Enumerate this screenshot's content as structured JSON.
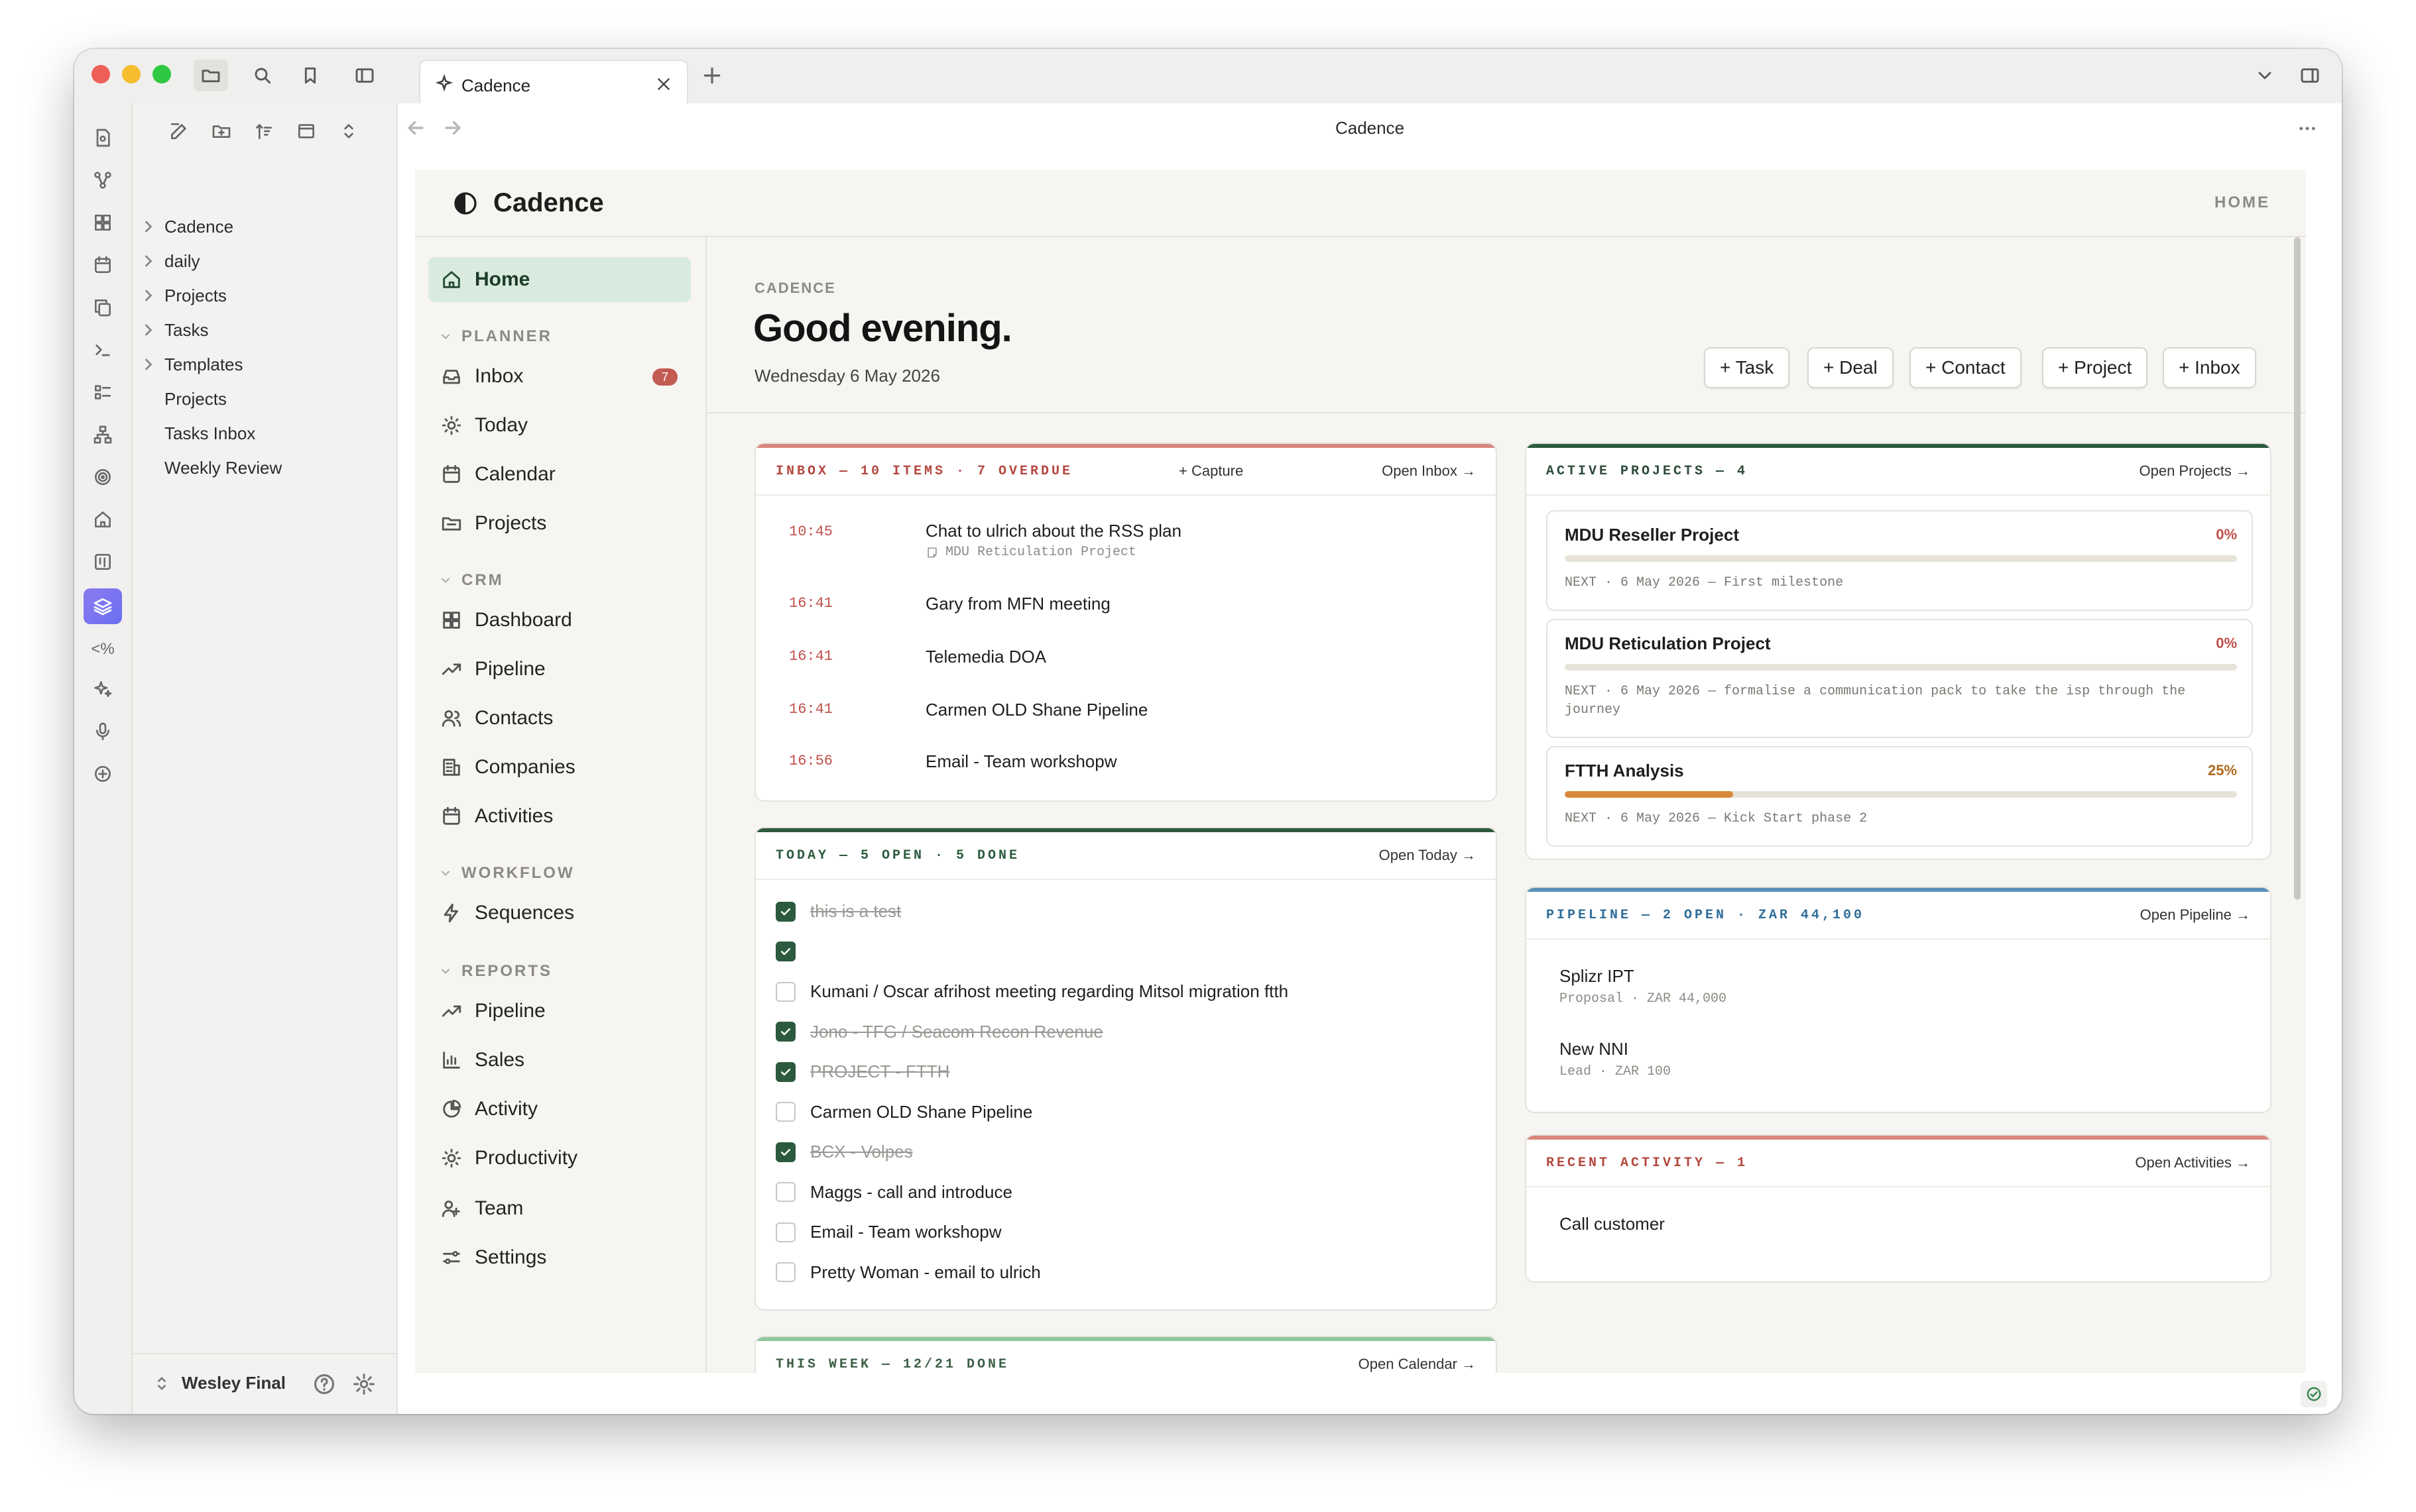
{
  "tab": {
    "label": "Cadence"
  },
  "view_title": "Cadence",
  "explorer": {
    "folders": [
      "Cadence",
      "daily",
      "Projects",
      "Tasks",
      "Templates"
    ],
    "files": [
      "Projects",
      "Tasks Inbox",
      "Weekly Review"
    ],
    "vault_name": "Wesley Final"
  },
  "app": {
    "brand": "Cadence",
    "breadcrumb": "HOME",
    "nav": {
      "home": "Home",
      "planner_title": "PLANNER",
      "planner": [
        {
          "label": "Inbox",
          "icon": "inbox-icon",
          "badge": "7"
        },
        {
          "label": "Today",
          "icon": "sun-icon"
        },
        {
          "label": "Calendar",
          "icon": "calendar-icon"
        },
        {
          "label": "Projects",
          "icon": "folder-icon"
        }
      ],
      "crm_title": "CRM",
      "crm": [
        {
          "label": "Dashboard",
          "icon": "dashboard-icon"
        },
        {
          "label": "Pipeline",
          "icon": "trend-icon"
        },
        {
          "label": "Contacts",
          "icon": "users-icon"
        },
        {
          "label": "Companies",
          "icon": "building-icon"
        },
        {
          "label": "Activities",
          "icon": "calendar-icon"
        }
      ],
      "workflow_title": "WORKFLOW",
      "workflow": [
        {
          "label": "Sequences",
          "icon": "bolt-icon"
        }
      ],
      "reports_title": "REPORTS",
      "reports": [
        {
          "label": "Pipeline",
          "icon": "trend-icon"
        },
        {
          "label": "Sales",
          "icon": "bar-chart-icon"
        },
        {
          "label": "Activity",
          "icon": "pie-icon"
        },
        {
          "label": "Productivity",
          "icon": "sun-icon"
        },
        {
          "label": "Team",
          "icon": "team-icon"
        },
        {
          "label": "Settings",
          "icon": "sliders-icon"
        }
      ]
    },
    "header": {
      "eyebrow": "CADENCE",
      "greeting": "Good evening.",
      "date": "Wednesday 6 May 2026",
      "actions": [
        "+ Task",
        "+ Deal",
        "+ Contact",
        "+ Project",
        "+ Inbox"
      ]
    },
    "inbox": {
      "title": "INBOX — 10 ITEMS · 7 OVERDUE",
      "capture": "+ Capture",
      "link": "Open Inbox →",
      "items": [
        {
          "time": "10:45",
          "text": "Chat to ulrich about the RSS plan",
          "sub": "MDU Reticulation Project"
        },
        {
          "time": "16:41",
          "text": "Gary from MFN meeting"
        },
        {
          "time": "16:41",
          "text": "Telemedia DOA"
        },
        {
          "time": "16:41",
          "text": "Carmen OLD Shane Pipeline"
        },
        {
          "time": "16:56",
          "text": "Email - Team workshopw"
        }
      ]
    },
    "today": {
      "title": "TODAY — 5 OPEN · 5 DONE",
      "link": "Open Today →",
      "items": [
        {
          "text": "this is a test",
          "done": true
        },
        {
          "text": "",
          "done": true
        },
        {
          "text": "Kumani / Oscar afrihost meeting regarding Mitsol migration ftth",
          "done": false
        },
        {
          "text": "Jono - TFG / Seacom Recon Revenue",
          "done": true
        },
        {
          "text": "PROJECT - FTTH",
          "done": true
        },
        {
          "text": "Carmen OLD Shane Pipeline",
          "done": false
        },
        {
          "text": "BCX - Volpes",
          "done": true
        },
        {
          "text": "Maggs - call and introduce",
          "done": false
        },
        {
          "text": "Email - Team workshopw",
          "done": false
        },
        {
          "text": "Pretty Woman - email to ulrich",
          "done": false
        }
      ]
    },
    "week": {
      "title": "THIS WEEK — 12/21 DONE",
      "link": "Open Calendar →"
    },
    "projects": {
      "title": "ACTIVE PROJECTS — 4",
      "link": "Open Projects →",
      "items": [
        {
          "name": "MDU Reseller Project",
          "pct_label": "0%",
          "progress": 0,
          "next": "NEXT · 6 May 2026 — First milestone"
        },
        {
          "name": "MDU Reticulation Project",
          "pct_label": "0%",
          "progress": 0,
          "next": "NEXT · 6 May 2026 — formalise a communication pack to take the isp through the journey"
        },
        {
          "name": "FTTH Analysis",
          "pct_label": "25%",
          "progress": 0.25,
          "next": "NEXT · 6 May 2026 — Kick Start phase 2"
        }
      ]
    },
    "pipeline": {
      "title": "PIPELINE — 2 OPEN · ZAR 44,100",
      "link": "Open Pipeline →",
      "deals": [
        {
          "name": "Splizr IPT",
          "sub": "Proposal · ZAR 44,000"
        },
        {
          "name": "New NNI",
          "sub": "Lead · ZAR 100"
        }
      ]
    },
    "activity": {
      "title": "RECENT ACTIVITY — 1",
      "link": "Open Activities →",
      "items": [
        {
          "name": "Call customer"
        }
      ]
    }
  },
  "colors": {
    "accent_green": "#2c5a3e",
    "inbox_red": "#c0504a",
    "pipeline_blue": "#5a8fb8",
    "week_green": "#8fc79a",
    "progress_orange": "#d9893a"
  }
}
